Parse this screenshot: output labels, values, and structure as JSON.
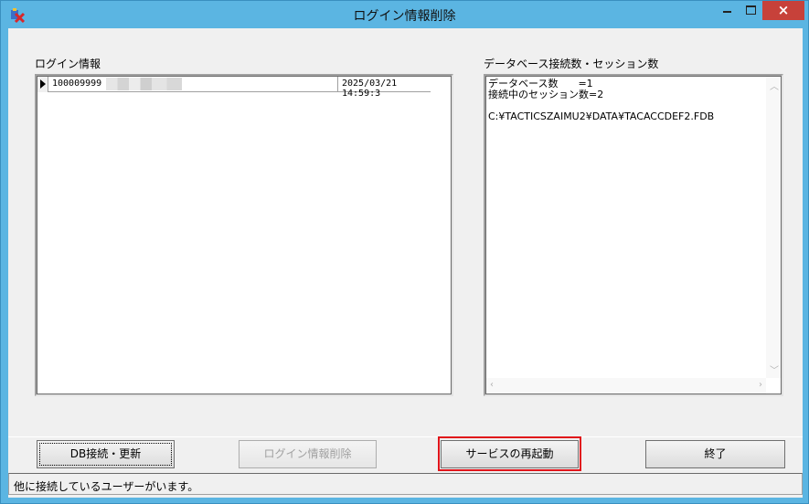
{
  "window": {
    "title": "ログイン情報削除"
  },
  "login_panel": {
    "label": "ログイン情報",
    "rows": [
      {
        "id": "100009999",
        "time": "2025/03/21 14:59:3"
      }
    ]
  },
  "db_panel": {
    "label": "データベース接続数・セッション数",
    "text": "データベース数　　=1\n接続中のセッション数=2\n\nC:¥TACTICSZAIMU2¥DATA¥TACACCDEF2.FDB"
  },
  "buttons": {
    "db_connect": "DB接続・更新",
    "delete_login": "ログイン情報削除",
    "restart_service": "サービスの再起動",
    "exit": "終了"
  },
  "status": {
    "message": "他に接続しているユーザーがいます。"
  },
  "colors": {
    "titlebar": "#5bb5e2",
    "close_button": "#c7413a",
    "highlight": "#e1141a"
  }
}
